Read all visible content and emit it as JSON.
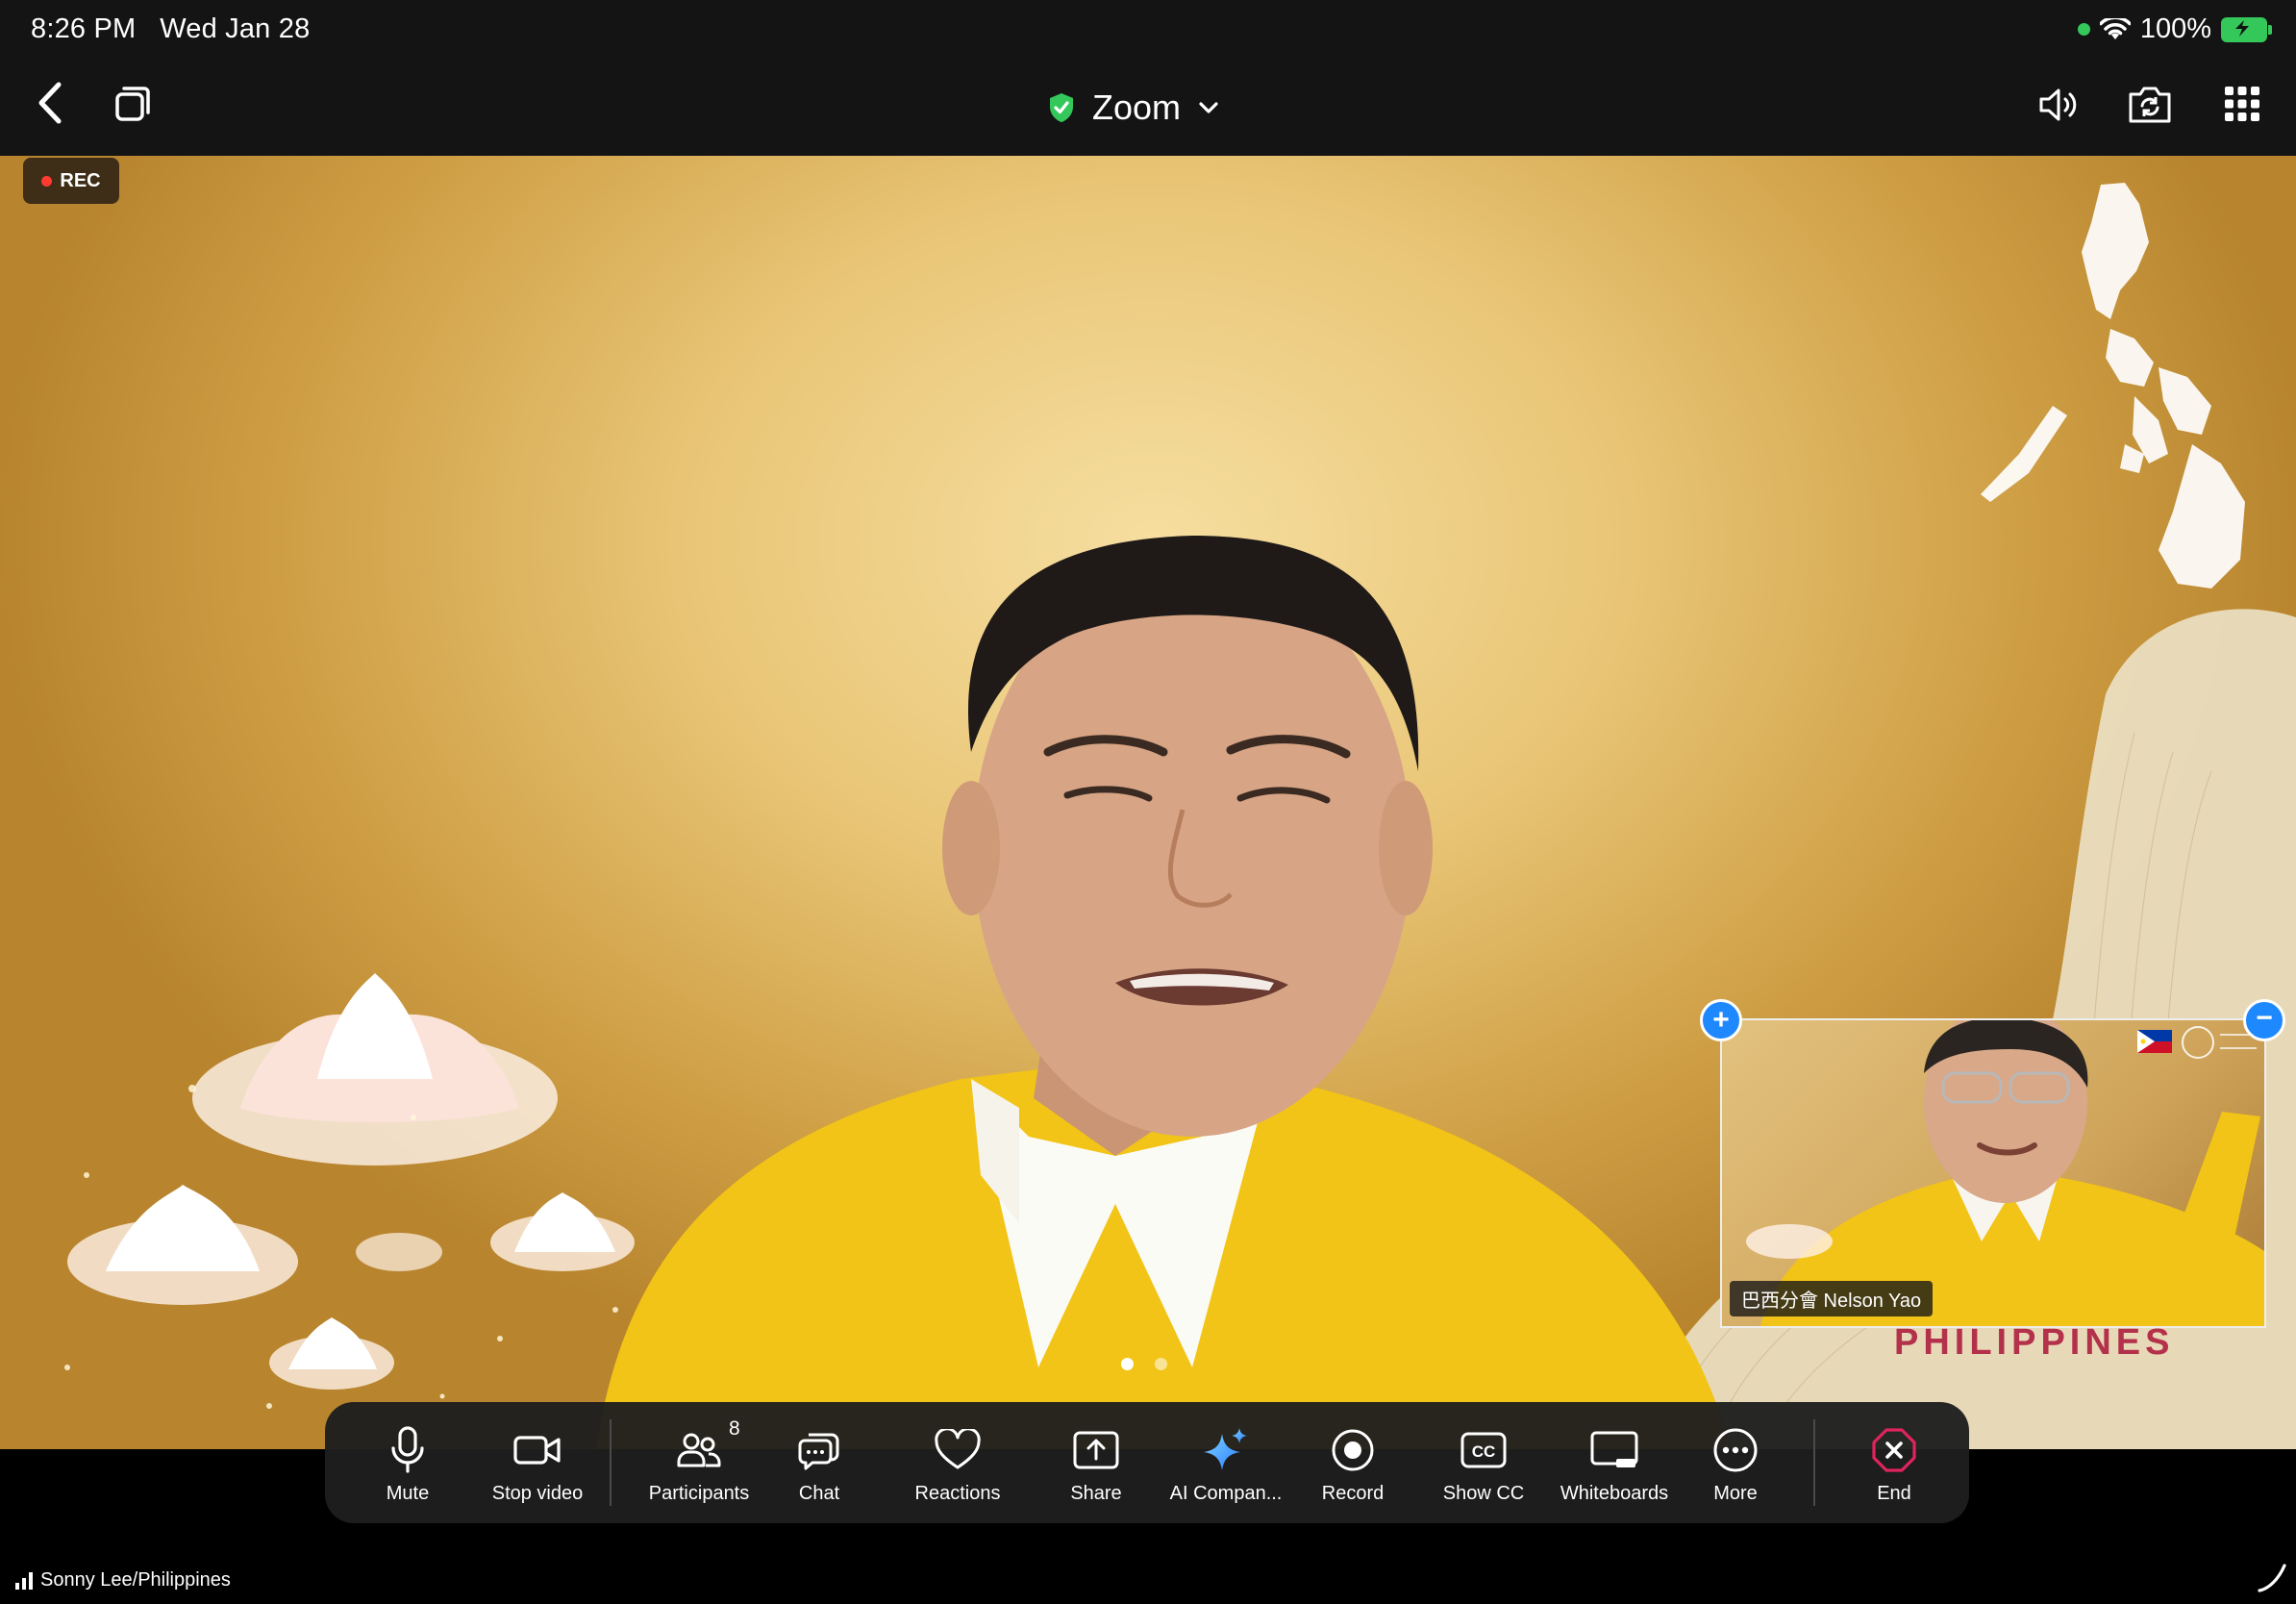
{
  "status_bar": {
    "time": "8:26 PM",
    "date": "Wed Jan 28",
    "battery_percent": "100%",
    "icons": [
      "camera-in-use-dot",
      "wifi-icon",
      "battery-charging-icon"
    ]
  },
  "top_bar": {
    "title": "Zoom",
    "icons": [
      "back-chevron-icon",
      "window-switch-icon",
      "shield-check-icon",
      "chevron-down-icon",
      "speaker-icon",
      "camera-switch-icon",
      "apps-grid-icon"
    ],
    "accent_color": "#34c759"
  },
  "recording": {
    "label": "REC",
    "color": "#ff3b30"
  },
  "stage": {
    "page_count": 2,
    "active_page": 1,
    "background_text": "PHILIPPINES"
  },
  "pip": {
    "name": "巴西分會 Nelson Yao"
  },
  "toolbar": {
    "items": [
      {
        "label": "Mute",
        "icon": "microphone-icon"
      },
      {
        "label": "Stop video",
        "icon": "video-camera-icon"
      },
      {
        "label": "Participants",
        "icon": "participants-icon",
        "count": "8"
      },
      {
        "label": "Chat",
        "icon": "chat-icon"
      },
      {
        "label": "Reactions",
        "icon": "heart-icon"
      },
      {
        "label": "Share",
        "icon": "share-icon"
      },
      {
        "label": "AI Compan...",
        "icon": "sparkle-icon"
      },
      {
        "label": "Record",
        "icon": "record-icon"
      },
      {
        "label": "Show CC",
        "icon": "cc-icon"
      },
      {
        "label": "Whiteboards",
        "icon": "whiteboard-icon"
      },
      {
        "label": "More",
        "icon": "more-icon"
      },
      {
        "label": "End",
        "icon": "end-call-icon"
      }
    ],
    "end_color": "#e0245e"
  },
  "footer": {
    "speaker_label": "Sonny Lee/Philippines"
  }
}
